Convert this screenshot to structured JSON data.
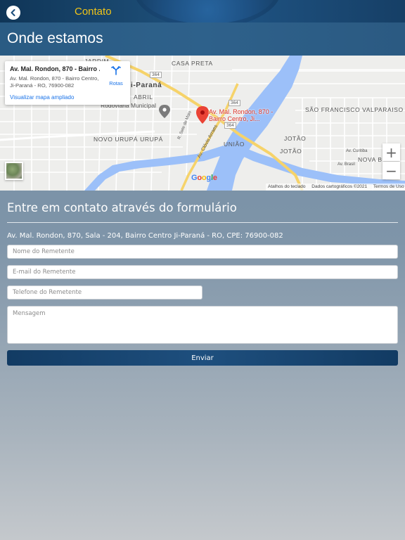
{
  "header": {
    "title": "Contato",
    "back_icon": "chevron-left-icon",
    "title_color": "#f0c419"
  },
  "section": {
    "title": "Onde estamos"
  },
  "map": {
    "place_card": {
      "name": "Av. Mal. Rondon, 870 - Bairro ...",
      "address": "Av. Mal. Rondon, 870 - Bairro Centro, Ji-Paraná - RO, 76900-082",
      "routes_label": "Rotas",
      "view_larger_link": "Visualizar mapa ampliado"
    },
    "pin_label_line1": "Av. Mal. Rondon, 870 -",
    "pin_label_line2": "Bairro Centro, Ji...",
    "labels": {
      "jardim": "JARDIM",
      "casa_preta": "CASA PRETA",
      "ji_parana": "i-Paraná",
      "abril": "ABRIL",
      "rodoviaria": "Rodoviária Municipal",
      "sao_francisco": "SÃO FRANCISCO VALPARAISO",
      "novo_urupa": "NOVO URUPÁ URUPÁ",
      "uniao": "UNIÃO",
      "jotao1": "JOTÃO",
      "jotao2": "JOTÃO",
      "nova_b": "NOVA B",
      "road_364a": "364",
      "road_364b": "364",
      "road_364c": "364",
      "rua_sete": "R. Sete de Maio",
      "av_clovis": "Av. Clóvis Arraes",
      "av_curitiba": "Av. Curitiba",
      "av_brasil": "Av. Brasil"
    },
    "zoom_in": "+",
    "zoom_out": "−",
    "google": [
      "G",
      "o",
      "o",
      "g",
      "l",
      "e"
    ],
    "attribution": {
      "keyboard": "Atalhos do teclado",
      "map_data": "Dados cartográficos ©2021",
      "terms": "Termos de Uso"
    }
  },
  "form": {
    "title": "Entre em contato através do formulário",
    "address": "Av. Mal. Rondon, 870, Sala - 204, Bairro Centro Ji-Paraná - RO, CPE: 76900-082",
    "name_placeholder": "Nome do Remetente",
    "email_placeholder": "E-mail do Remetente",
    "phone_placeholder": "Telefone do Remetente",
    "message_placeholder": "Mensagem",
    "submit_label": "Enviar"
  }
}
